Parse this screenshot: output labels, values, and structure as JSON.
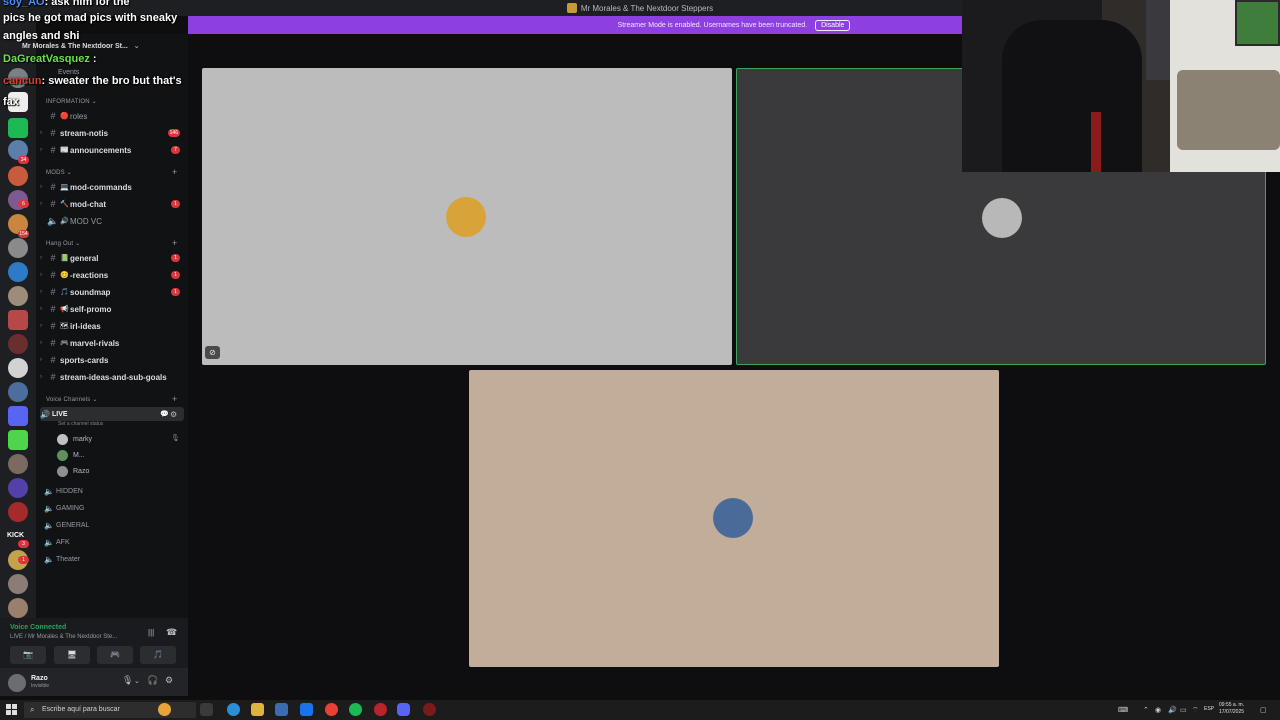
{
  "window": {
    "title": "Mr Morales & The Nextdoor Steppers"
  },
  "streamer_bar": {
    "message": "Streamer Mode is enabled. Usernames have been truncated.",
    "disable_label": "Disable"
  },
  "server": {
    "header": "Mr Morales & The Nextdoor St...",
    "events_label": "Events"
  },
  "chat_overlay": {
    "line1_user": "soy_AO",
    "line1_text": ": ask him for the",
    "line2_text": "pics he got mad pics with sneaky",
    "line3_text": "angles and shi",
    "line4_user": "DaGreatVasquez",
    "line4_text": " :",
    "line5_user": "cancun",
    "line5_text": ": sweater the bro but that's",
    "line6_text": "fax"
  },
  "categories": [
    {
      "label": "INFORMATION"
    },
    {
      "label": "MODS"
    },
    {
      "label": "Hang Out"
    },
    {
      "label": "Voice Channels"
    }
  ],
  "channels": [
    {
      "name": "roles",
      "emoji": "🔴",
      "badge": ""
    },
    {
      "name": "stream-notis",
      "emoji": "",
      "badge": "146"
    },
    {
      "name": "announcements",
      "emoji": "📰",
      "badge": "7"
    },
    {
      "name": "mod-commands",
      "emoji": "💻",
      "badge": ""
    },
    {
      "name": "mod-chat",
      "emoji": "🔨",
      "badge": "1"
    },
    {
      "name": "MOD VC",
      "emoji": "🔊",
      "badge": ""
    },
    {
      "name": "general",
      "emoji": "📗",
      "badge": "1"
    },
    {
      "name": "-reactions",
      "emoji": "😊",
      "badge": "1"
    },
    {
      "name": "soundmap",
      "emoji": "🎵",
      "badge": "1"
    },
    {
      "name": "self-promo",
      "emoji": "📢",
      "badge": ""
    },
    {
      "name": "irl-ideas",
      "emoji": "🗺",
      "badge": ""
    },
    {
      "name": "marvel-rivals",
      "emoji": "🎮",
      "badge": ""
    },
    {
      "name": "sports-cards",
      "emoji": "",
      "badge": ""
    },
    {
      "name": "stream-ideas-and-sub-goals",
      "emoji": "",
      "badge": ""
    }
  ],
  "voice_channels": {
    "live": {
      "name": "LIVE",
      "status": "Set a channel status"
    },
    "users": [
      {
        "name": "marky"
      },
      {
        "name": "M..."
      },
      {
        "name": "Razo"
      }
    ],
    "others": [
      {
        "name": "HIDDEN"
      },
      {
        "name": "GAMING"
      },
      {
        "name": "GENERAL"
      },
      {
        "name": "AFK"
      },
      {
        "name": "Theater"
      }
    ]
  },
  "voice_panel": {
    "status": "Voice Connected",
    "location": "LIVE / Mr Morales & The Nextdoor Ste..."
  },
  "user_panel": {
    "name": "Razo",
    "status": "Invisible"
  },
  "server_badges": [
    "34",
    "6",
    "154",
    "3",
    "1"
  ],
  "rail_label": "KICK",
  "taskbar": {
    "search_placeholder": "Escribe aquí para buscar",
    "lang": "ESP",
    "time": "09:55 a. m.",
    "date": "17/07/2025"
  },
  "colors": {
    "accent_purple": "#8e3fe0",
    "speaking_green": "#3ba55c",
    "mention_red": "#da373c",
    "tile_gray": "#bcbcbc",
    "tile_dark": "#3a3a3d",
    "tile_tan": "#c2ad9a"
  }
}
